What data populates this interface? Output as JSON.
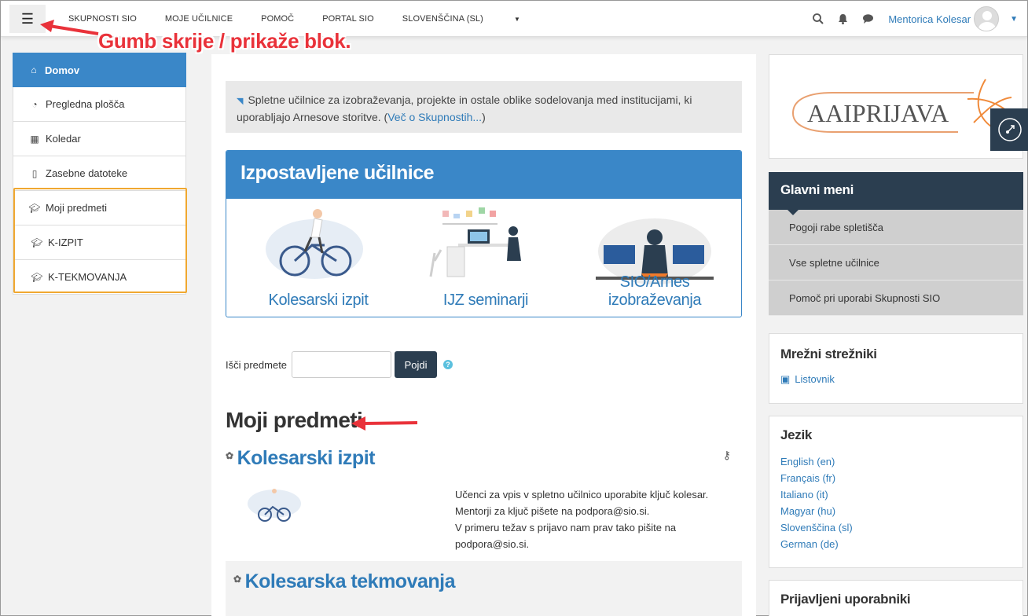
{
  "navbar": {
    "menu_icon": "hamburger-icon",
    "links": [
      "SKUPNOSTI SIO",
      "MOJE UČILNICE",
      "POMOČ",
      "PORTAL SIO",
      "SLOVENŠČINA (SL)"
    ],
    "user_name": "Mentorica Kolesar"
  },
  "annotation": {
    "text": "Gumb skrije / prikaže blok."
  },
  "left_nav": {
    "items": [
      {
        "label": "Domov",
        "icon": "home-icon"
      },
      {
        "label": "Pregledna plošča",
        "icon": "dashboard-icon"
      },
      {
        "label": "Koledar",
        "icon": "calendar-icon"
      },
      {
        "label": "Zasebne datoteke",
        "icon": "file-icon"
      },
      {
        "label": "Moji predmeti",
        "icon": "graduation-cap-icon"
      },
      {
        "label": "K-IZPIT",
        "icon": "graduation-cap-icon"
      },
      {
        "label": "K-TEKMOVANJA",
        "icon": "graduation-cap-icon"
      }
    ]
  },
  "main": {
    "info_text": "Spletne učilnice za izobraževanja, projekte in ostale oblike sodelovanja med institucijami, ki uporabljajo Arnesove storitve. (",
    "info_link": "Več o Skupnostih...",
    "info_close": ")",
    "featured": {
      "title": "Izpostavljene učilnice",
      "cards": [
        "Kolesarski izpit",
        "IJZ seminarji",
        "SIO/Arnes izobraževanja"
      ]
    },
    "search": {
      "label": "Išči predmete",
      "value": "",
      "button": "Pojdi"
    },
    "my_courses_title": "Moji predmeti",
    "courses": [
      {
        "title": "Kolesarski izpit",
        "summary": [
          "Učenci za vpis v spletno učilnico uporabite ključ kolesar.",
          "Mentorji za ključ pišete na podpora@sio.si.",
          "V primeru težav s prijavo nam prav tako pišite na",
          "podpora@sio.si."
        ]
      },
      {
        "title": "Kolesarska tekmovanja"
      }
    ]
  },
  "right": {
    "logo_text": "AAIPRIJAVA",
    "main_menu": {
      "title": "Glavni meni",
      "items": [
        "Pogoji rabe spletišča",
        "Vse spletne učilnice",
        "Pomoč pri uporabi Skupnosti SIO"
      ]
    },
    "servers": {
      "title": "Mrežni strežniki",
      "items": [
        "Listovnik"
      ]
    },
    "language": {
      "title": "Jezik",
      "items": [
        "English (en)",
        "Français (fr)",
        "Italiano (it)",
        "Magyar (hu)",
        "Slovenščina (sl)",
        "German (de)"
      ]
    },
    "online": {
      "title": "Prijavljeni uporabniki"
    }
  },
  "colors": {
    "primary": "#3a87c8",
    "dark": "#2b3e50",
    "annotation": "#e9323a",
    "highlight": "#f0a830"
  }
}
